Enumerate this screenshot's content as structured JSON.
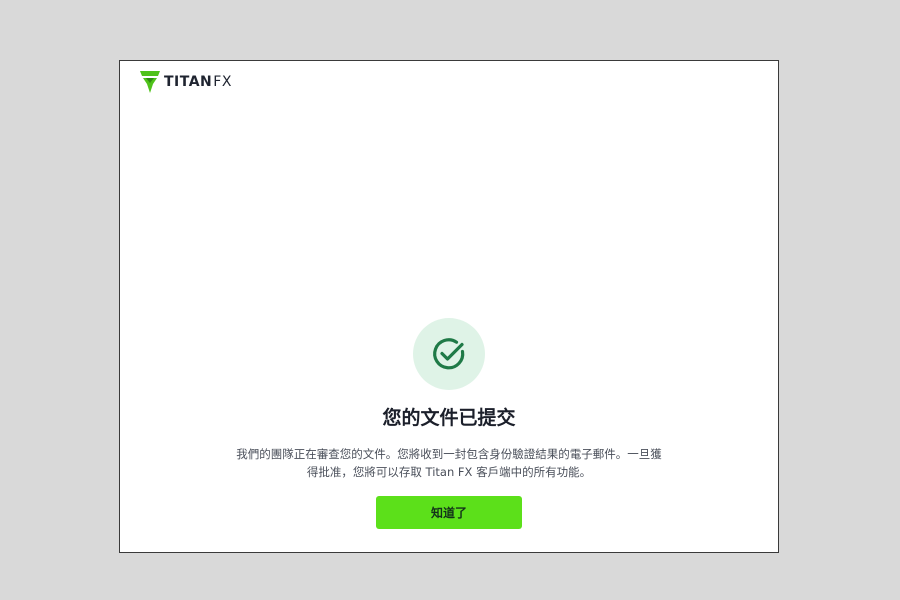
{
  "brand": {
    "name_titan": "TITAN",
    "name_fx": "FX",
    "logo_icon": "titan-fx-logo-icon",
    "accent_color": "#5ce01a",
    "check_color": "#1f7a47",
    "check_bg_color": "#dff3e7"
  },
  "dialog": {
    "status_icon": "check-circle-icon",
    "title": "您的文件已提交",
    "description": "我們的團隊正在審查您的文件。您將收到一封包含身份驗證結果的電子郵件。一旦獲得批准，您將可以存取 Titan FX 客戶端中的所有功能。",
    "button_label": "知道了"
  }
}
